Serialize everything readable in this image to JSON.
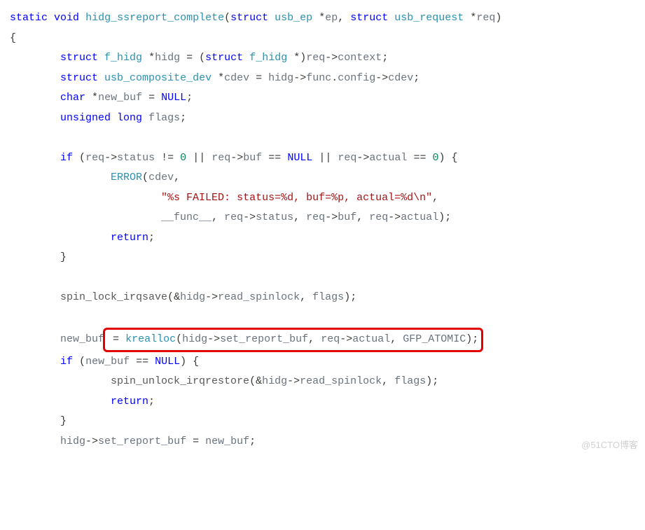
{
  "code": {
    "l1a": "static",
    "l1b": "void",
    "l1c": "hidg_ssreport_complete",
    "l1d": "struct",
    "l1e": "usb_ep",
    "l1f": "ep",
    "l1g": "struct",
    "l1h": "usb_request",
    "l1i": "req",
    "l3a": "struct",
    "l3b": "f_hidg",
    "l3c": "hidg",
    "l3d": "struct",
    "l3e": "f_hidg",
    "l3f": "req",
    "l3g": "context",
    "l4a": "struct",
    "l4b": "usb_composite_dev",
    "l4c": "cdev",
    "l4d": "hidg",
    "l4e": "func",
    "l4f": "config",
    "l4g": "cdev",
    "l5a": "char",
    "l5b": "new_buf",
    "l5c": "NULL",
    "l6a": "unsigned",
    "l6b": "long",
    "l6c": "flags",
    "l8a": "if",
    "l8b": "req",
    "l8c": "status",
    "l8d": "0",
    "l8e": "req",
    "l8f": "buf",
    "l8g": "NULL",
    "l8h": "req",
    "l8i": "actual",
    "l8j": "0",
    "l9a": "ERROR",
    "l9b": "cdev",
    "l10a": "\"%s FAILED: status=%d, buf=%p, actual=%d\\n\"",
    "l11a": "__func__",
    "l11b": "req",
    "l11c": "status",
    "l11d": "req",
    "l11e": "buf",
    "l11f": "req",
    "l11g": "actual",
    "l12a": "return",
    "l15a": "spin_lock_irqsave",
    "l15b": "hidg",
    "l15c": "read_spinlock",
    "l15d": "flags",
    "l17a": "new_buf",
    "l17b": "krealloc",
    "l17c": "hidg",
    "l17d": "set_report_buf",
    "l17e": "req",
    "l17f": "actual",
    "l17g": "GFP_ATOMIC",
    "l18a": "if",
    "l18b": "new_buf",
    "l18c": "NULL",
    "l19a": "spin_unlock_irqrestore",
    "l19b": "hidg",
    "l19c": "read_spinlock",
    "l19d": "flags",
    "l20a": "return",
    "l22a": "hidg",
    "l22b": "set_report_buf",
    "l22c": "new_buf"
  },
  "watermark": "@51CTO博客"
}
